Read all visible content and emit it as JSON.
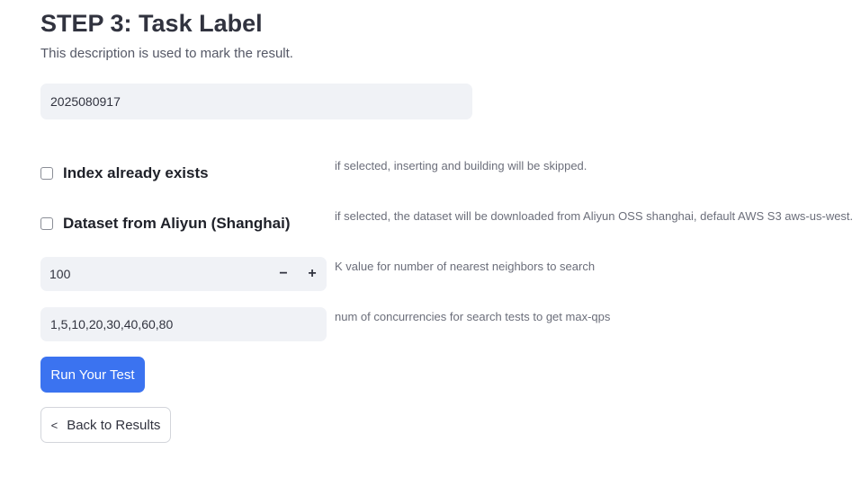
{
  "header": {
    "title": "STEP 3: Task Label",
    "description": "This description is used to mark the result."
  },
  "task_label": {
    "value": "2025080917"
  },
  "options": [
    {
      "label": "Index already exists",
      "checked": false,
      "help": "if selected, inserting and building will be skipped."
    },
    {
      "label": "Dataset from Aliyun (Shanghai)",
      "checked": false,
      "help": "if selected, the dataset will be downloaded from Aliyun OSS shanghai, default AWS S3 aws-us-west."
    }
  ],
  "k_value": {
    "value": "100",
    "minus_label": "−",
    "plus_label": "+",
    "help": "K value for number of nearest neighbors to search"
  },
  "concurrency": {
    "value": "1,5,10,20,30,40,60,80",
    "help": "num of concurrencies for search tests to get max-qps"
  },
  "buttons": {
    "run_label": "Run Your Test",
    "back_label": "Back to Results",
    "back_icon": "<"
  },
  "colors": {
    "primary": "#3b73f0",
    "input_bg": "#f0f2f6"
  }
}
